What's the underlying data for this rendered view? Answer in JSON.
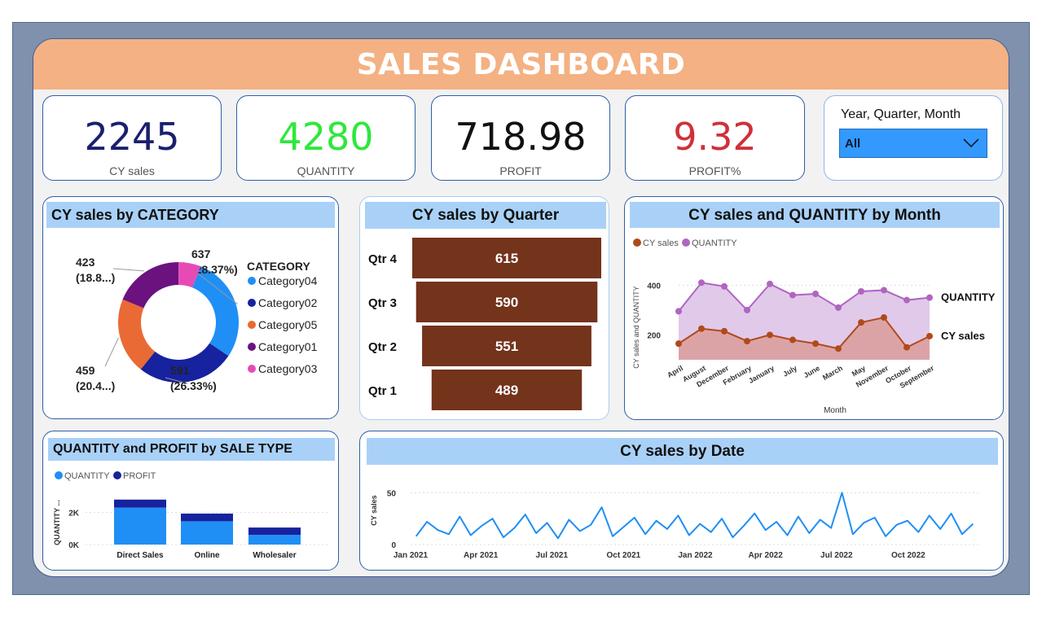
{
  "title": "SALES DASHBOARD",
  "kpis": [
    {
      "value": "2245",
      "label": "CY sales",
      "color": "#1a1f6e"
    },
    {
      "value": "4280",
      "label": "QUANTITY",
      "color": "#2ee83c"
    },
    {
      "value": "718.98",
      "label": "PROFIT",
      "color": "#111111"
    },
    {
      "value": "9.32",
      "label": "PROFIT%",
      "color": "#d0303a"
    }
  ],
  "slicer": {
    "title": "Year, Quarter, Month",
    "value": "All"
  },
  "colors": {
    "banner": "#f4b183",
    "frame": "#7f91ad",
    "title_bar": "#a9d1f7",
    "funnel": "#74331b",
    "cy_sales": "#b04a1a",
    "quantity": "#b065c0",
    "bar_quantity": "#1f8ff5",
    "bar_profit": "#17229e",
    "date_line": "#1f8ff5"
  },
  "chart_data": [
    {
      "type": "pie",
      "title": "CY sales by CATEGORY",
      "legend_title": "CATEGORY",
      "legend_position": "right",
      "slices": [
        {
          "name": "Category04",
          "value": 637,
          "label": "637",
          "pct": "(28.37%)",
          "color": "#1f8ff5"
        },
        {
          "name": "Category02",
          "value": 591,
          "label": "591",
          "pct": "(26.33%)",
          "color": "#17229e"
        },
        {
          "name": "Category05",
          "value": 459,
          "label": "459",
          "pct": "(20.4...)",
          "color": "#ea6a35"
        },
        {
          "name": "Category01",
          "value": 423,
          "label": "423",
          "pct": "(18.8...)",
          "color": "#6b1280"
        },
        {
          "name": "Category03",
          "value": 135,
          "color": "#e64bb5"
        }
      ]
    },
    {
      "type": "bar",
      "orientation": "funnel",
      "title": "CY sales by Quarter",
      "categories": [
        "Qtr 4",
        "Qtr 3",
        "Qtr 2",
        "Qtr 1"
      ],
      "values": [
        615,
        590,
        551,
        489
      ]
    },
    {
      "type": "area",
      "title": "CY sales and QUANTITY by Month",
      "xlabel": "Month",
      "ylabel": "CY sales and QUANTITY",
      "legend_position": "top-left",
      "categories": [
        "April",
        "August",
        "December",
        "February",
        "January",
        "July",
        "June",
        "March",
        "May",
        "November",
        "October",
        "September"
      ],
      "y_ticks": [
        200,
        400
      ],
      "ylim": [
        100,
        460
      ],
      "series": [
        {
          "name": "CY sales",
          "values": [
            165,
            225,
            215,
            175,
            200,
            180,
            165,
            145,
            250,
            270,
            150,
            195
          ]
        },
        {
          "name": "QUANTITY",
          "values": [
            295,
            410,
            395,
            300,
            405,
            360,
            365,
            310,
            375,
            380,
            340,
            350
          ]
        }
      ]
    },
    {
      "type": "bar",
      "stacked": true,
      "title": "QUANTITY and PROFIT by SALE TYPE",
      "ylabel": "QUANTITY ...",
      "y_ticks": [
        "0K",
        "2K"
      ],
      "legend_position": "top-left",
      "categories": [
        "Direct Sales",
        "Online",
        "Wholesaler"
      ],
      "ylim": [
        0,
        3600
      ],
      "series": [
        {
          "name": "QUANTITY",
          "values": [
            2300,
            1450,
            600
          ]
        },
        {
          "name": "PROFIT",
          "values": [
            500,
            480,
            460
          ]
        }
      ]
    },
    {
      "type": "line",
      "title": "CY sales by Date",
      "ylabel": "CY sales",
      "x_ticks": [
        "Jan 2021",
        "Apr 2021",
        "Jul 2021",
        "Oct 2021",
        "Jan 2022",
        "Apr 2022",
        "Jul 2022",
        "Oct 2022"
      ],
      "y_ticks": [
        0,
        50
      ],
      "ylim": [
        0,
        55
      ],
      "x": [
        "2021-01-08",
        "2021-01-22",
        "2021-02-05",
        "2021-02-19",
        "2021-03-05",
        "2021-03-19",
        "2021-04-02",
        "2021-04-16",
        "2021-04-30",
        "2021-05-14",
        "2021-05-28",
        "2021-06-11",
        "2021-06-25",
        "2021-07-09",
        "2021-07-23",
        "2021-08-06",
        "2021-08-20",
        "2021-09-03",
        "2021-09-17",
        "2021-10-01",
        "2021-10-15",
        "2021-10-29",
        "2021-11-12",
        "2021-11-26",
        "2021-12-10",
        "2021-12-24",
        "2022-01-07",
        "2022-01-21",
        "2022-02-04",
        "2022-02-18",
        "2022-03-04",
        "2022-03-18",
        "2022-04-01",
        "2022-04-15",
        "2022-04-29",
        "2022-05-13",
        "2022-05-27",
        "2022-06-10",
        "2022-06-24",
        "2022-07-08",
        "2022-07-22",
        "2022-08-05",
        "2022-08-19",
        "2022-09-02",
        "2022-09-16",
        "2022-09-30",
        "2022-10-14",
        "2022-10-28",
        "2022-11-11",
        "2022-11-25",
        "2022-12-09",
        "2022-12-23"
      ],
      "values": [
        8,
        22,
        14,
        10,
        27,
        9,
        18,
        25,
        7,
        16,
        29,
        11,
        21,
        6,
        24,
        13,
        19,
        36,
        8,
        17,
        26,
        10,
        23,
        15,
        28,
        9,
        20,
        12,
        25,
        7,
        18,
        30,
        14,
        22,
        9,
        27,
        11,
        24,
        16,
        50,
        10,
        21,
        26,
        8,
        19,
        23,
        12,
        28,
        15,
        30,
        10,
        20
      ]
    }
  ]
}
